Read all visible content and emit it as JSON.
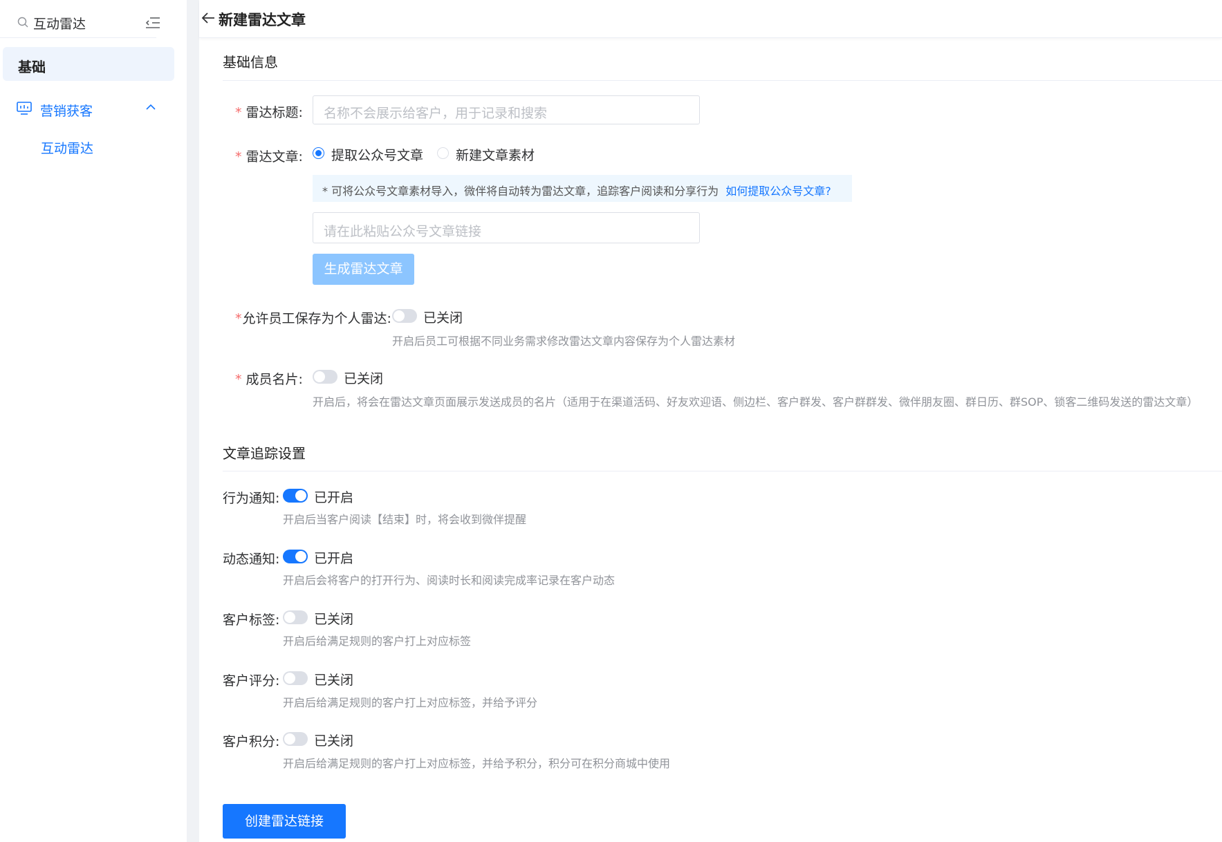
{
  "sidebar": {
    "search_text": "互动雷达",
    "base_label": "基础",
    "group_label": "营销获客",
    "sub_item": "互动雷达"
  },
  "header": {
    "title": "新建雷达文章"
  },
  "basic_info": {
    "section_title": "基础信息",
    "title_label": "雷达标题:",
    "title_placeholder": "名称不会展示给客户，用于记录和搜索",
    "article_label": "雷达文章:",
    "radio_extract": "提取公众号文章",
    "radio_new": "新建文章素材",
    "tip_text": "* 可将公众号文章素材导入，微伴将自动转为雷达文章，追踪客户阅读和分享行为",
    "tip_link": "如何提取公众号文章?",
    "link_placeholder": "请在此粘贴公众号文章链接",
    "generate_button": "生成雷达文章",
    "save_personal_label": "允许员工保存为个人雷达:",
    "save_personal_status": "已关闭",
    "save_personal_hint": "开启后员工可根据不同业务需求修改雷达文章内容保存为个人雷达素材",
    "member_card_label": "成员名片:",
    "member_card_status": "已关闭",
    "member_card_hint": "开启后，将会在雷达文章页面展示发送成员的名片（适用于在渠道活码、好友欢迎语、侧边栏、客户群发、客户群群发、微伴朋友圈、群日历、群SOP、锁客二维码发送的雷达文章）"
  },
  "tracking": {
    "section_title": "文章追踪设置",
    "items": [
      {
        "label": "行为通知:",
        "status": "已开启",
        "on": true,
        "hint": "开启后当客户阅读【结束】时，将会收到微伴提醒"
      },
      {
        "label": "动态通知:",
        "status": "已开启",
        "on": true,
        "hint": "开启后会将客户的打开行为、阅读时长和阅读完成率记录在客户动态"
      },
      {
        "label": "客户标签:",
        "status": "已关闭",
        "on": false,
        "hint": "开启后给满足规则的客户打上对应标签"
      },
      {
        "label": "客户评分:",
        "status": "已关闭",
        "on": false,
        "hint": "开启后给满足规则的客户打上对应标签，并给予评分"
      },
      {
        "label": "客户积分:",
        "status": "已关闭",
        "on": false,
        "hint": "开启后给满足规则的客户打上对应标签，并给予积分，积分可在积分商城中使用"
      }
    ]
  },
  "submit_button": "创建雷达链接",
  "colors": {
    "primary": "#1677ff",
    "required": "#f56c6c",
    "disabled_button": "#8cc5ff",
    "tip_bg": "#eef7fe"
  },
  "icons": {
    "search": "search-icon",
    "collapse": "menu-collapse-icon",
    "group": "monitor-icon",
    "chevron": "chevron-up-icon",
    "back": "arrow-left-icon"
  }
}
